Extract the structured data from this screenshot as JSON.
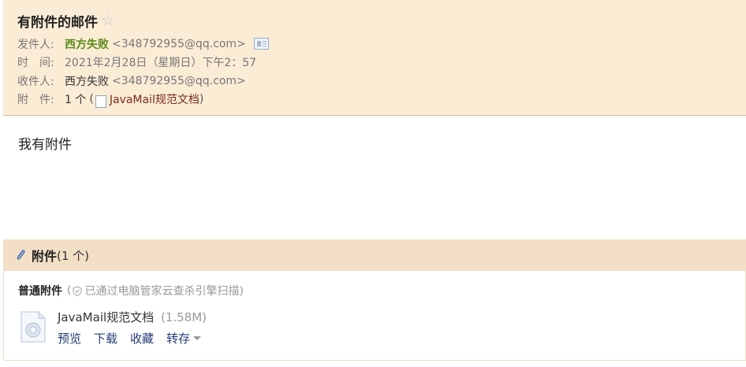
{
  "header": {
    "subject": "有附件的邮件",
    "sender_label": "发件人:",
    "sender_name": "西方失败",
    "sender_addr": "<348792955@qq.com>",
    "time_label": "时　间:",
    "time_value": "2021年2月28日（星期日）下午2：57",
    "recipient_label": "收件人:",
    "recipient_name": "西方失败",
    "recipient_addr": "<348792955@qq.com>",
    "attachment_label": "附　件:",
    "attachment_count": "1 个",
    "attachment_open": "(",
    "attachment_name": "JavaMail规范文档",
    "attachment_close": ")"
  },
  "body": {
    "text": "我有附件"
  },
  "attachments": {
    "title": "附件",
    "count": "(1 个)",
    "normal_label": "普通附件",
    "scan_open": "(",
    "scan_text": "已通过电脑管家云查杀引擎扫描)",
    "file": {
      "name": "JavaMail规范文档",
      "size": "(1.58M)",
      "actions": {
        "preview": "预览",
        "download": "下载",
        "favorite": "收藏",
        "forward": "转存"
      }
    }
  },
  "colors": {
    "header_bg": "#fbecd6",
    "sender_green": "#5d8a1a",
    "link_dark_red": "#7a2b1b",
    "action_blue": "#223a77",
    "attach_head_bg": "#f3dfc6"
  },
  "icons": [
    "star-icon",
    "contact-card-icon",
    "document-icon",
    "paperclip-icon",
    "shield-icon",
    "file-type-icon",
    "caret-down-icon"
  ]
}
